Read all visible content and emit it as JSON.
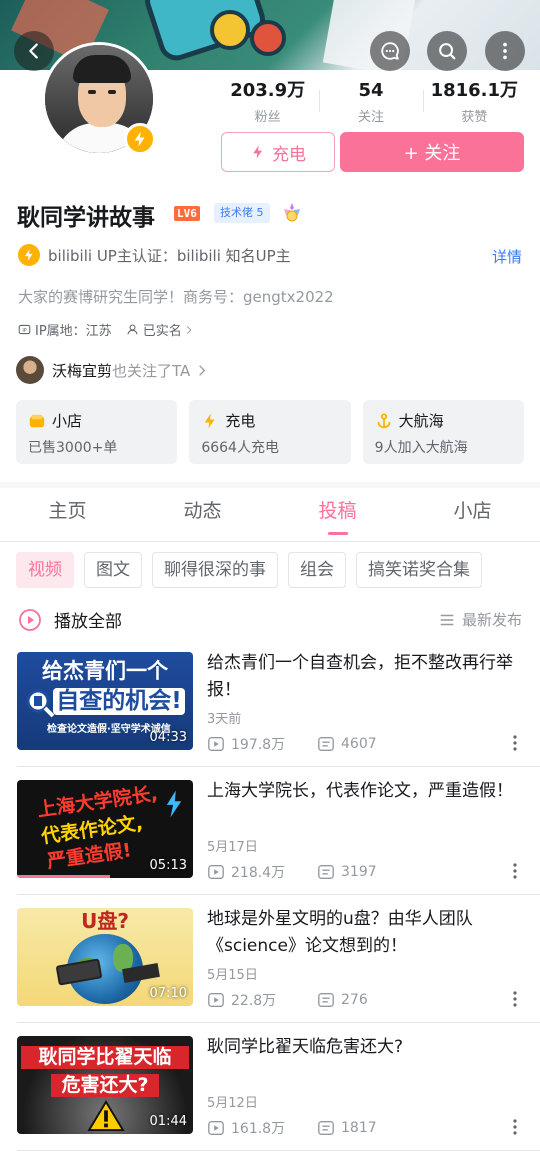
{
  "profile": {
    "name": "耿同学讲故事",
    "level": "LV6",
    "tech_tag": "技术佬 5",
    "stats": [
      {
        "value": "203.9万",
        "label": "粉丝"
      },
      {
        "value": "54",
        "label": "关注"
      },
      {
        "value": "1816.1万",
        "label": "获赞"
      }
    ],
    "charge_label": "充电",
    "follow_label": "+ 关注",
    "verify_text": "bilibili UP主认证：bilibili 知名UP主",
    "detail_label": "详情",
    "bio": "大家的赛博研究生同学！商务号：gengtx2022",
    "ip_location": "IP属地：江苏",
    "real_name": "已实名",
    "mutual_name": "沃梅宜剪",
    "mutual_suffix": "也关注了TA"
  },
  "cards": [
    {
      "title": "小店",
      "sub": "已售3000+单",
      "icon": "shop-icon"
    },
    {
      "title": "充电",
      "sub": "6664人充电",
      "icon": "bolt-icon"
    },
    {
      "title": "大航海",
      "sub": "9人加入大航海",
      "icon": "anchor-icon"
    }
  ],
  "tabs": [
    "主页",
    "动态",
    "投稿",
    "小店"
  ],
  "active_tab": "投稿",
  "chips": [
    "视频",
    "图文",
    "聊得很深的事",
    "组会",
    "搞笑诺奖合集"
  ],
  "play_all_label": "播放全部",
  "sort_label": "最新发布",
  "videos": [
    {
      "title": "给杰青们一个自查机会，拒不整改再行举报！",
      "date": "3天前",
      "views": "197.8万",
      "danmaku": "4607",
      "duration": "04:33",
      "thumb_lines": [
        "给杰青们一个",
        "自查的机会!"
      ],
      "thumb_sub": "检查论文造假·坚守学术诚信"
    },
    {
      "title": "上海大学院长，代表作论文，严重造假！",
      "date": "5月17日",
      "views": "218.4万",
      "danmaku": "3197",
      "duration": "05:13",
      "thumb_lines": [
        "上海大学院长,",
        "代表作论文,",
        "严重造假!"
      ],
      "progress": 0.53
    },
    {
      "title": "地球是外星文明的u盘？由华人团队《science》论文想到的！",
      "date": "5月15日",
      "views": "22.8万",
      "danmaku": "276",
      "duration": "07:10",
      "thumb_lines": [
        "U盘?"
      ]
    },
    {
      "title": "耿同学比翟天临危害还大?",
      "date": "5月12日",
      "views": "161.8万",
      "danmaku": "1817",
      "duration": "01:44",
      "thumb_lines": [
        "耿同学比翟天临",
        "危害还大?"
      ]
    }
  ],
  "colors": {
    "accent": "#fb7299",
    "link": "#3a7af2",
    "gold": "#ffb300"
  }
}
